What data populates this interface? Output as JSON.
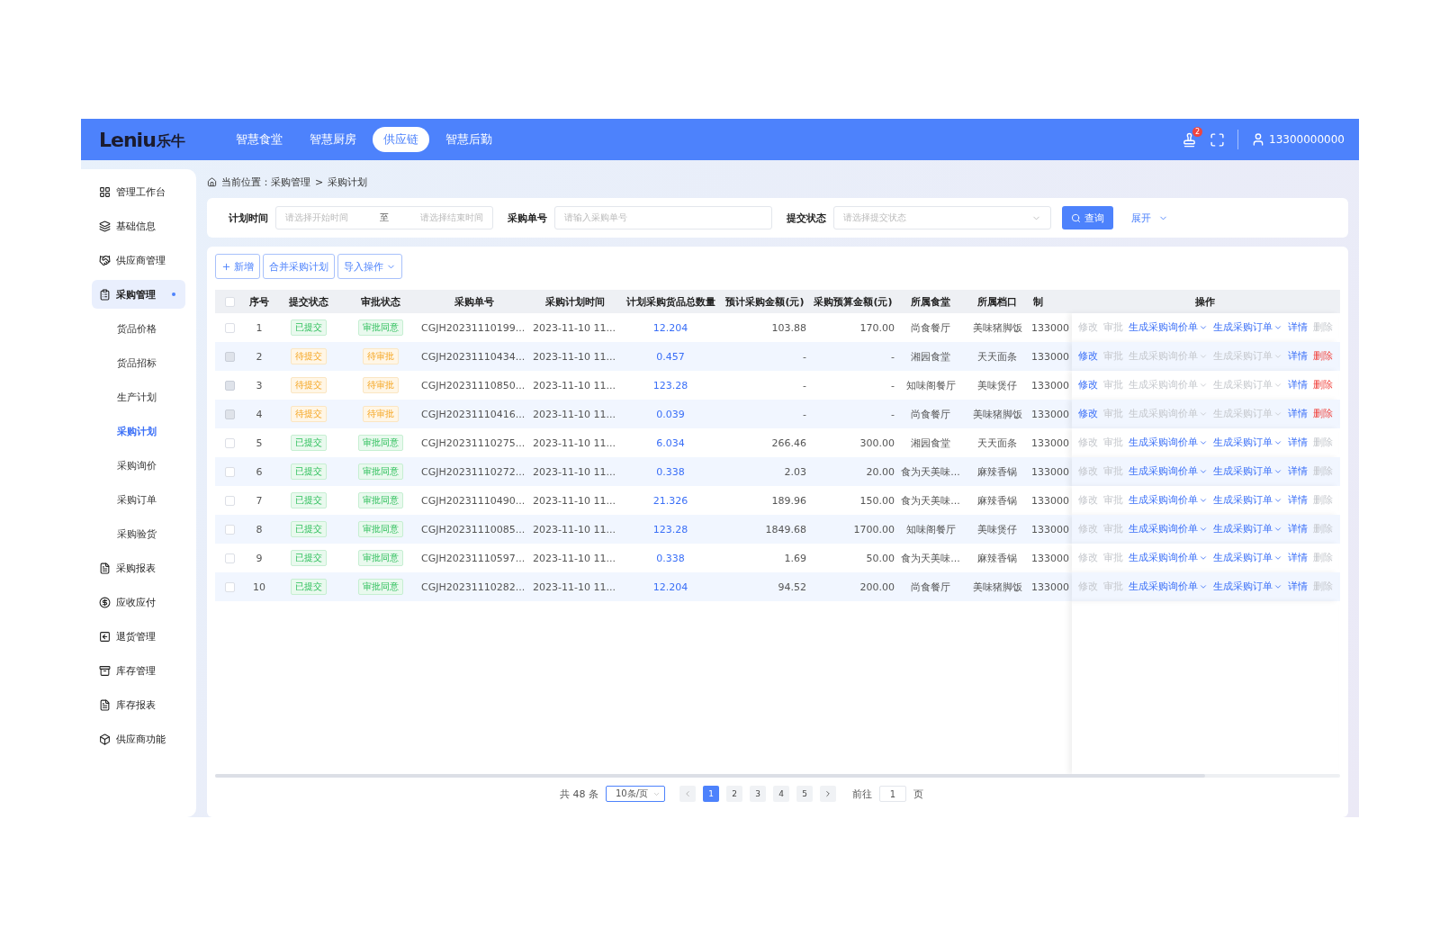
{
  "header": {
    "logo": "Leniu",
    "logo_cn": "乐牛",
    "tabs": [
      {
        "label": "智慧食堂",
        "selected": false
      },
      {
        "label": "智慧厨房",
        "selected": false
      },
      {
        "label": "供应链",
        "selected": true
      },
      {
        "label": "智慧后勤",
        "selected": false
      }
    ],
    "badge": "2",
    "user": "13300000000"
  },
  "sidebar": {
    "items": [
      {
        "label": "管理工作台",
        "selected": false
      },
      {
        "label": "基础信息",
        "selected": false
      },
      {
        "label": "供应商管理",
        "selected": false
      },
      {
        "label": "采购管理",
        "selected": true,
        "children": [
          {
            "label": "货品价格",
            "selected": false
          },
          {
            "label": "货品招标",
            "selected": false
          },
          {
            "label": "生产计划",
            "selected": false
          },
          {
            "label": "采购计划",
            "selected": true
          },
          {
            "label": "采购询价",
            "selected": false
          },
          {
            "label": "采购订单",
            "selected": false
          },
          {
            "label": "采购验货",
            "selected": false
          }
        ]
      },
      {
        "label": "采购报表",
        "selected": false
      },
      {
        "label": "应收应付",
        "selected": false
      },
      {
        "label": "退货管理",
        "selected": false
      },
      {
        "label": "库存管理",
        "selected": false
      },
      {
        "label": "库存报表",
        "selected": false
      },
      {
        "label": "供应商功能",
        "selected": false
      }
    ]
  },
  "breadcrumb": [
    "当前位置：采购管理",
    ">",
    "采购计划"
  ],
  "filters": {
    "time_label": "计划时间",
    "start_placeholder": "请选择开始时间",
    "separator": "至",
    "end_placeholder": "请选择结束时间",
    "order_label": "采购单号",
    "order_placeholder": "请输入采购单号",
    "status_label": "提交状态",
    "status_placeholder": "请选择提交状态",
    "search_button": "查询",
    "expand_link": "展开"
  },
  "toolbar": [
    "新增",
    "合并采购计划",
    "导入操作"
  ],
  "table": {
    "select_all_checked": false,
    "columns": [
      "序号",
      "提交状态",
      "审批状态",
      "采购单号",
      "采购计划时间",
      "计划采购货品总数量",
      "预计采购金额(元)",
      "采购预算金额(元)",
      "所属食堂",
      "所属档口",
      "制",
      "操作"
    ],
    "rows": [
      {
        "index": "1",
        "checked": false,
        "checkbox_disabled": false,
        "submit": {
          "text": "已提交",
          "kind": "done"
        },
        "approval": {
          "text": "审批同意",
          "kind": "done"
        },
        "order_no": "CGJH20231110199...",
        "time": "2023-11-10 11...",
        "qty": "12.204",
        "estimate": "103.88",
        "budget": "170.00",
        "canteen": "尚食餐厅",
        "stall": "美味猪脚饭",
        "maker": "133000",
        "actions": [
          {
            "label": "修改",
            "kind": "link",
            "disabled": true
          },
          {
            "label": "审批",
            "kind": "link",
            "disabled": true
          },
          {
            "label": "生成采购询价单",
            "kind": "dropdown",
            "disabled": false
          },
          {
            "label": "生成采购订单",
            "kind": "dropdown",
            "disabled": false
          },
          {
            "label": "详情",
            "kind": "link",
            "disabled": false
          },
          {
            "label": "删除",
            "kind": "danger",
            "disabled": true
          }
        ]
      },
      {
        "index": "2",
        "checked": false,
        "checkbox_disabled": true,
        "submit": {
          "text": "待提交",
          "kind": "pending"
        },
        "approval": {
          "text": "待审批",
          "kind": "pending"
        },
        "order_no": "CGJH20231110434...",
        "time": "2023-11-10 11...",
        "qty": "0.457",
        "estimate": "-",
        "budget": "-",
        "canteen": "湘园食堂",
        "stall": "天天面条",
        "maker": "133000",
        "actions": [
          {
            "label": "修改",
            "kind": "link",
            "disabled": false
          },
          {
            "label": "审批",
            "kind": "link",
            "disabled": true
          },
          {
            "label": "生成采购询价单",
            "kind": "dropdown",
            "disabled": true
          },
          {
            "label": "生成采购订单",
            "kind": "dropdown",
            "disabled": true
          },
          {
            "label": "详情",
            "kind": "link",
            "disabled": false
          },
          {
            "label": "删除",
            "kind": "danger",
            "disabled": false
          }
        ]
      },
      {
        "index": "3",
        "checked": false,
        "checkbox_disabled": true,
        "submit": {
          "text": "待提交",
          "kind": "pending"
        },
        "approval": {
          "text": "待审批",
          "kind": "pending"
        },
        "order_no": "CGJH20231110850...",
        "time": "2023-11-10 11...",
        "qty": "123.28",
        "estimate": "-",
        "budget": "-",
        "canteen": "知味阁餐厅",
        "stall": "美味煲仔",
        "maker": "133000",
        "actions": [
          {
            "label": "修改",
            "kind": "link",
            "disabled": false
          },
          {
            "label": "审批",
            "kind": "link",
            "disabled": true
          },
          {
            "label": "生成采购询价单",
            "kind": "dropdown",
            "disabled": true
          },
          {
            "label": "生成采购订单",
            "kind": "dropdown",
            "disabled": true
          },
          {
            "label": "详情",
            "kind": "link",
            "disabled": false
          },
          {
            "label": "删除",
            "kind": "danger",
            "disabled": false
          }
        ]
      },
      {
        "index": "4",
        "checked": false,
        "checkbox_disabled": true,
        "submit": {
          "text": "待提交",
          "kind": "pending"
        },
        "approval": {
          "text": "待审批",
          "kind": "pending"
        },
        "order_no": "CGJH20231110416...",
        "time": "2023-11-10 11...",
        "qty": "0.039",
        "estimate": "-",
        "budget": "-",
        "canteen": "尚食餐厅",
        "stall": "美味猪脚饭",
        "maker": "133000",
        "actions": [
          {
            "label": "修改",
            "kind": "link",
            "disabled": false
          },
          {
            "label": "审批",
            "kind": "link",
            "disabled": true
          },
          {
            "label": "生成采购询价单",
            "kind": "dropdown",
            "disabled": true
          },
          {
            "label": "生成采购订单",
            "kind": "dropdown",
            "disabled": true
          },
          {
            "label": "详情",
            "kind": "link",
            "disabled": false
          },
          {
            "label": "删除",
            "kind": "danger",
            "disabled": false
          }
        ]
      },
      {
        "index": "5",
        "checked": false,
        "checkbox_disabled": false,
        "submit": {
          "text": "已提交",
          "kind": "done"
        },
        "approval": {
          "text": "审批同意",
          "kind": "done"
        },
        "order_no": "CGJH20231110275...",
        "time": "2023-11-10 11...",
        "qty": "6.034",
        "estimate": "266.46",
        "budget": "300.00",
        "canteen": "湘园食堂",
        "stall": "天天面条",
        "maker": "133000",
        "actions": [
          {
            "label": "修改",
            "kind": "link",
            "disabled": true
          },
          {
            "label": "审批",
            "kind": "link",
            "disabled": true
          },
          {
            "label": "生成采购询价单",
            "kind": "dropdown",
            "disabled": false
          },
          {
            "label": "生成采购订单",
            "kind": "dropdown",
            "disabled": false
          },
          {
            "label": "详情",
            "kind": "link",
            "disabled": false
          },
          {
            "label": "删除",
            "kind": "danger",
            "disabled": true
          }
        ]
      },
      {
        "index": "6",
        "checked": false,
        "checkbox_disabled": false,
        "submit": {
          "text": "已提交",
          "kind": "done"
        },
        "approval": {
          "text": "审批同意",
          "kind": "done"
        },
        "order_no": "CGJH20231110272...",
        "time": "2023-11-10 11...",
        "qty": "0.338",
        "estimate": "2.03",
        "budget": "20.00",
        "canteen": "食为天美味...",
        "stall": "麻辣香锅",
        "maker": "133000",
        "actions": [
          {
            "label": "修改",
            "kind": "link",
            "disabled": true
          },
          {
            "label": "审批",
            "kind": "link",
            "disabled": true
          },
          {
            "label": "生成采购询价单",
            "kind": "dropdown",
            "disabled": false
          },
          {
            "label": "生成采购订单",
            "kind": "dropdown",
            "disabled": false
          },
          {
            "label": "详情",
            "kind": "link",
            "disabled": false
          },
          {
            "label": "删除",
            "kind": "danger",
            "disabled": true
          }
        ]
      },
      {
        "index": "7",
        "checked": false,
        "checkbox_disabled": false,
        "submit": {
          "text": "已提交",
          "kind": "done"
        },
        "approval": {
          "text": "审批同意",
          "kind": "done"
        },
        "order_no": "CGJH20231110490...",
        "time": "2023-11-10 11...",
        "qty": "21.326",
        "estimate": "189.96",
        "budget": "150.00",
        "canteen": "食为天美味...",
        "stall": "麻辣香锅",
        "maker": "133000",
        "actions": [
          {
            "label": "修改",
            "kind": "link",
            "disabled": true
          },
          {
            "label": "审批",
            "kind": "link",
            "disabled": true
          },
          {
            "label": "生成采购询价单",
            "kind": "dropdown",
            "disabled": false
          },
          {
            "label": "生成采购订单",
            "kind": "dropdown",
            "disabled": false
          },
          {
            "label": "详情",
            "kind": "link",
            "disabled": false
          },
          {
            "label": "删除",
            "kind": "danger",
            "disabled": true
          }
        ]
      },
      {
        "index": "8",
        "checked": false,
        "checkbox_disabled": false,
        "submit": {
          "text": "已提交",
          "kind": "done"
        },
        "approval": {
          "text": "审批同意",
          "kind": "done"
        },
        "order_no": "CGJH20231110085...",
        "time": "2023-11-10 11...",
        "qty": "123.28",
        "estimate": "1849.68",
        "budget": "1700.00",
        "canteen": "知味阁餐厅",
        "stall": "美味煲仔",
        "maker": "133000",
        "actions": [
          {
            "label": "修改",
            "kind": "link",
            "disabled": true
          },
          {
            "label": "审批",
            "kind": "link",
            "disabled": true
          },
          {
            "label": "生成采购询价单",
            "kind": "dropdown",
            "disabled": false
          },
          {
            "label": "生成采购订单",
            "kind": "dropdown",
            "disabled": false
          },
          {
            "label": "详情",
            "kind": "link",
            "disabled": false
          },
          {
            "label": "删除",
            "kind": "danger",
            "disabled": true
          }
        ]
      },
      {
        "index": "9",
        "checked": false,
        "checkbox_disabled": false,
        "submit": {
          "text": "已提交",
          "kind": "done"
        },
        "approval": {
          "text": "审批同意",
          "kind": "done"
        },
        "order_no": "CGJH20231110597...",
        "time": "2023-11-10 11...",
        "qty": "0.338",
        "estimate": "1.69",
        "budget": "50.00",
        "canteen": "食为天美味...",
        "stall": "麻辣香锅",
        "maker": "133000",
        "actions": [
          {
            "label": "修改",
            "kind": "link",
            "disabled": true
          },
          {
            "label": "审批",
            "kind": "link",
            "disabled": true
          },
          {
            "label": "生成采购询价单",
            "kind": "dropdown",
            "disabled": false
          },
          {
            "label": "生成采购订单",
            "kind": "dropdown",
            "disabled": false
          },
          {
            "label": "详情",
            "kind": "link",
            "disabled": false
          },
          {
            "label": "删除",
            "kind": "danger",
            "disabled": true
          }
        ]
      },
      {
        "index": "10",
        "checked": false,
        "checkbox_disabled": false,
        "submit": {
          "text": "已提交",
          "kind": "done"
        },
        "approval": {
          "text": "审批同意",
          "kind": "done"
        },
        "order_no": "CGJH20231110282...",
        "time": "2023-11-10 11...",
        "qty": "12.204",
        "estimate": "94.52",
        "budget": "200.00",
        "canteen": "尚食餐厅",
        "stall": "美味猪脚饭",
        "maker": "133000",
        "actions": [
          {
            "label": "修改",
            "kind": "link",
            "disabled": true
          },
          {
            "label": "审批",
            "kind": "link",
            "disabled": true
          },
          {
            "label": "生成采购询价单",
            "kind": "dropdown",
            "disabled": false
          },
          {
            "label": "生成采购订单",
            "kind": "dropdown",
            "disabled": false
          },
          {
            "label": "详情",
            "kind": "link",
            "disabled": false
          },
          {
            "label": "删除",
            "kind": "danger",
            "disabled": true
          }
        ]
      }
    ]
  },
  "pagination": {
    "total": "共 48 条",
    "page_size": "10条/页",
    "pages": [
      {
        "label": "1",
        "selected": true
      },
      {
        "label": "2",
        "selected": false
      },
      {
        "label": "3",
        "selected": false
      },
      {
        "label": "4",
        "selected": false
      },
      {
        "label": "5",
        "selected": false
      }
    ],
    "goto_label": "前往",
    "goto_value": "1",
    "page_unit": "页"
  }
}
